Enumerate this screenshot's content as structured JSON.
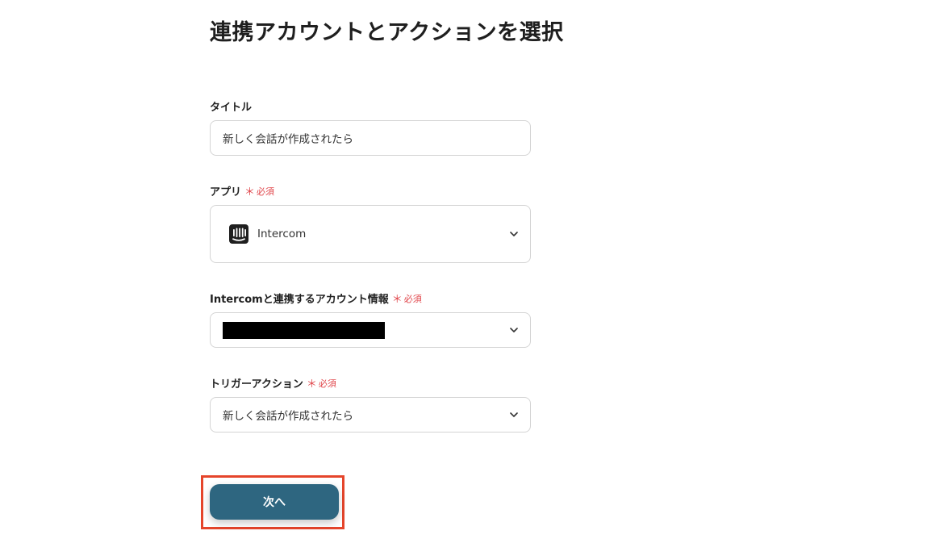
{
  "page": {
    "title": "連携アカウントとアクションを選択"
  },
  "form": {
    "title_field": {
      "label": "タイトル",
      "value": "新しく会話が作成されたら"
    },
    "app_field": {
      "label": "アプリ",
      "required_label": "必須",
      "required_mark": "＊",
      "value": "Intercom",
      "icon": "intercom-logo"
    },
    "account_field": {
      "label": "Intercomと連携するアカウント情報",
      "required_label": "必須",
      "required_mark": "＊",
      "value_redacted": true
    },
    "trigger_field": {
      "label": "トリガーアクション",
      "required_label": "必須",
      "required_mark": "＊",
      "value": "新しく会話が作成されたら"
    }
  },
  "actions": {
    "next_label": "次へ"
  },
  "colors": {
    "required": "#e0454a",
    "primary_button": "#2e6680",
    "highlight_border": "#e5452b",
    "input_border": "#d4d4d4"
  }
}
